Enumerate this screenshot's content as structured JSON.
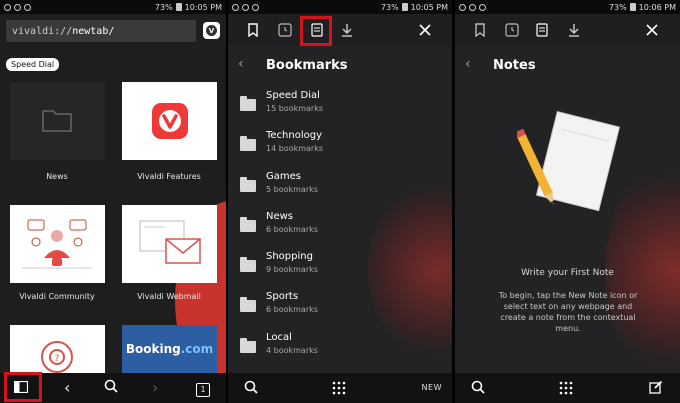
{
  "status_bars": [
    {
      "battery": "73%",
      "time": "10:05 PM"
    },
    {
      "battery": "73%",
      "time": "10:05 PM"
    },
    {
      "battery": "73%",
      "time": "10:06 PM"
    }
  ],
  "speed_dial_panel": {
    "url_prefix": "vivaldi://",
    "url_host": "newtab/",
    "chip_label": "Speed Dial",
    "tiles": [
      {
        "label": "News",
        "icon": "folder-icon"
      },
      {
        "label": "Vivaldi Features",
        "icon": "vivaldi-logo-icon"
      },
      {
        "label": "Vivaldi Community",
        "icon": "community-illustration-icon"
      },
      {
        "label": "Vivaldi Webmail",
        "icon": "webmail-illustration-icon"
      },
      {
        "label": "",
        "icon": "help-lifebuoy-icon"
      },
      {
        "label": "Booking.com",
        "icon": "booking-logo"
      }
    ],
    "booking_text_a": "Booking",
    "booking_text_b": ".com",
    "tab_count": "1"
  },
  "bookmarks_panel": {
    "title": "Bookmarks",
    "items": [
      {
        "name": "Speed Dial",
        "count": "15 bookmarks"
      },
      {
        "name": "Technology",
        "count": "14 bookmarks"
      },
      {
        "name": "Games",
        "count": "5 bookmarks"
      },
      {
        "name": "News",
        "count": "6 bookmarks"
      },
      {
        "name": "Shopping",
        "count": "9 bookmarks"
      },
      {
        "name": "Sports",
        "count": "6 bookmarks"
      },
      {
        "name": "Local",
        "count": "4 bookmarks"
      }
    ],
    "new_label": "NEW"
  },
  "notes_panel": {
    "title": "Notes",
    "heading": "Write your First Note",
    "body": "To begin, tap the New Note icon or select text on any webpage and create a note from the contextual menu."
  },
  "colors": {
    "accent_red": "#d4141c",
    "vivaldi_red": "#ef3939",
    "booking_blue": "#2d5ea2"
  }
}
